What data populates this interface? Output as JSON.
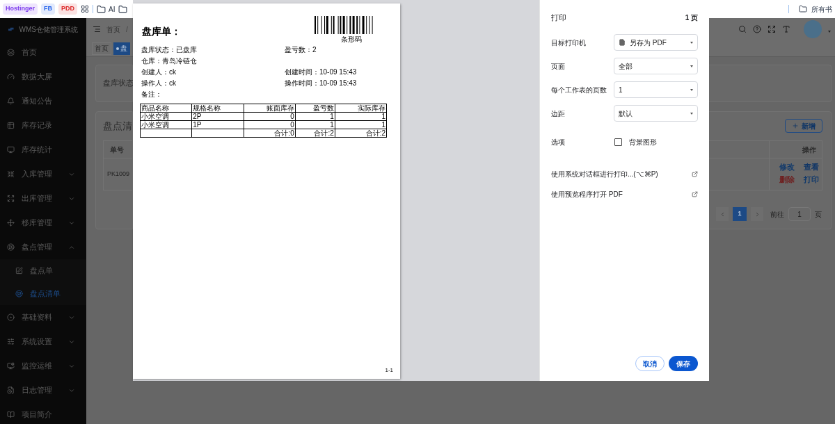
{
  "bookmarks_bar": {
    "items": [
      {
        "kind": "chip",
        "label": "Hostinger",
        "color": "#7c3aed"
      },
      {
        "kind": "chip",
        "label": "FB",
        "color": "#2563eb"
      },
      {
        "kind": "chip",
        "label": "PDD",
        "color": "#dc2626"
      },
      {
        "kind": "apps"
      },
      {
        "kind": "folder",
        "label": "AI"
      },
      {
        "kind": "folder"
      }
    ],
    "all_bookmarks": "所有书"
  },
  "sidebar": {
    "title": "WMS仓储管理系统",
    "items": [
      {
        "label": "首页",
        "has_children": false
      },
      {
        "label": "数据大屏",
        "has_children": false
      },
      {
        "label": "通知公告",
        "has_children": false
      },
      {
        "label": "库存记录",
        "has_children": false
      },
      {
        "label": "库存统计",
        "has_children": false
      },
      {
        "label": "入库管理",
        "has_children": true,
        "expanded": false
      },
      {
        "label": "出库管理",
        "has_children": true,
        "expanded": false
      },
      {
        "label": "移库管理",
        "has_children": true,
        "expanded": false
      },
      {
        "label": "盘点管理",
        "has_children": true,
        "expanded": true,
        "children": [
          {
            "label": "盘点单",
            "selected": false
          },
          {
            "label": "盘点清单",
            "selected": true
          }
        ]
      },
      {
        "label": "基础资料",
        "has_children": true,
        "expanded": false
      },
      {
        "label": "系统设置",
        "has_children": true,
        "expanded": false
      },
      {
        "label": "监控运维",
        "has_children": true,
        "expanded": false
      },
      {
        "label": "日志管理",
        "has_children": true,
        "expanded": false
      },
      {
        "label": "项目简介",
        "has_children": false
      }
    ]
  },
  "header": {
    "breadcrumb": "首页",
    "separator": "/"
  },
  "tabs": [
    {
      "label": "首页",
      "selected": false
    },
    {
      "label": "盘",
      "selected": true
    }
  ],
  "status_card": {
    "label": "盘库状态"
  },
  "list_card": {
    "title": "盘点清",
    "add_button": "新增",
    "columns": [
      {
        "label": "单号"
      },
      {
        "label": "操作"
      }
    ],
    "rows": [
      {
        "cells": [
          "PK1009"
        ],
        "actions": [
          {
            "label": "修改",
            "color": "#123a6b"
          },
          {
            "label": "查看",
            "color": "#0f3566"
          },
          {
            "label": "删除",
            "color": "#6e1d1d"
          },
          {
            "label": "打印",
            "color": "#123a6b"
          }
        ]
      }
    ],
    "pagination": {
      "pages": [
        {
          "label": "1",
          "selected": true
        }
      ],
      "goto_label": "前往",
      "goto_value": "1",
      "suffix": "页"
    }
  },
  "print_dialog": {
    "preview": {
      "title": "盘库单：",
      "barcode_caption": "条形码",
      "info_rows": [
        [
          "盘库状态：已盘库",
          "盈亏数：2"
        ],
        [
          "仓库：青岛冷链仓"
        ],
        [
          "创建人：ck",
          "创建时间：10-09 15:43"
        ],
        [
          "操作人：ck",
          "操作时间：10-09 15:43"
        ],
        [
          "备注："
        ]
      ],
      "table": {
        "columns": [
          "商品名称",
          "规格名称",
          "账面库存",
          "盈亏数",
          "实际库存"
        ],
        "rows": [
          [
            "小米空调",
            "2P",
            "0",
            "1",
            "1"
          ],
          [
            "小米空调",
            "1P",
            "0",
            "1",
            "1"
          ],
          [
            "",
            "",
            "合计:0",
            "合计:2",
            "合计:2"
          ]
        ]
      },
      "page_number": "1-1"
    },
    "settings": {
      "title": "打印",
      "page_count": "1 页",
      "selects": [
        {
          "label": "目标打印机",
          "value": "另存为 PDF",
          "kind": "printer"
        },
        {
          "label": "页面",
          "value": "全部",
          "kind": "plain"
        },
        {
          "label": "每个工作表的页数",
          "value": "1",
          "kind": "plain"
        },
        {
          "label": "边距",
          "value": "默认",
          "kind": "plain"
        }
      ],
      "options": {
        "label": "选项",
        "checkbox_label": "背景图形",
        "checked": false
      },
      "links": [
        "使用系统对话框进行打印...(⌥⌘P)",
        "使用预览程序打开 PDF"
      ],
      "cancel": "取消",
      "save": "保存"
    }
  }
}
